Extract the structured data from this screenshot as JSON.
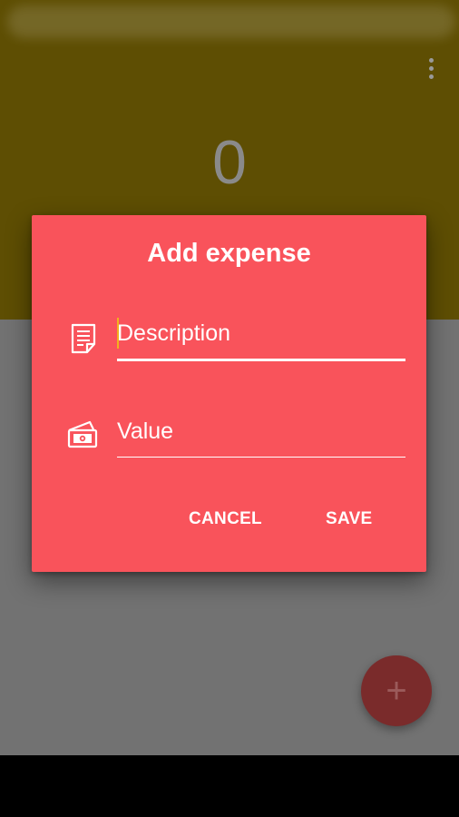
{
  "app": {
    "total_value": "0",
    "fab_label": "+",
    "colors": {
      "header": "#5e4e03",
      "content": "#727272",
      "fab": "#7a2b2b",
      "navbar": "#000000"
    }
  },
  "dialog": {
    "title": "Add expense",
    "background_color": "#f9535b",
    "description_field": {
      "placeholder": "Description",
      "value": "",
      "icon": "document-icon"
    },
    "value_field": {
      "placeholder": "Value",
      "value": "",
      "icon": "money-icon"
    },
    "cancel_label": "CANCEL",
    "save_label": "SAVE"
  }
}
